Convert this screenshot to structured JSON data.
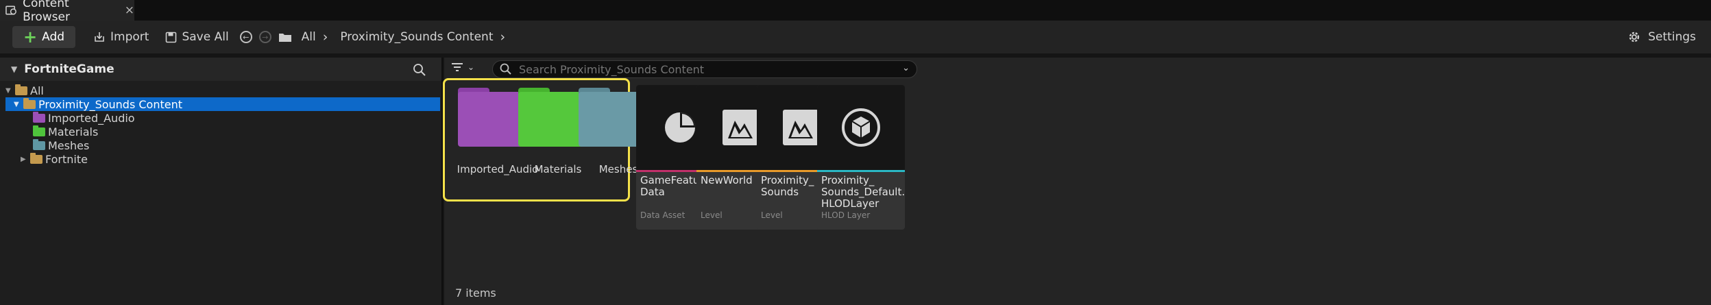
{
  "tab": {
    "title": "Content Browser",
    "close": "×"
  },
  "toolbar": {
    "add_label": "Add",
    "import_label": "Import",
    "save_all_label": "Save All",
    "breadcrumb": [
      "All",
      "Proximity_Sounds Content"
    ],
    "settings_label": "Settings"
  },
  "sources": {
    "title": "FortniteGame",
    "tree": [
      {
        "label": "All",
        "color": "#c49a4e"
      },
      {
        "label": "Proximity_Sounds Content",
        "color": "#c49a4e"
      },
      {
        "label": "Imported_Audio",
        "color": "#9b4fb6"
      },
      {
        "label": "Materials",
        "color": "#4fc43c"
      },
      {
        "label": "Meshes",
        "color": "#5f97a3"
      },
      {
        "label": "Fortnite",
        "color": "#c49a4e"
      }
    ]
  },
  "search": {
    "placeholder": "Search Proximity_Sounds Content"
  },
  "folders": [
    {
      "label": "Imported_Audio",
      "color": "#9b4fb6",
      "tab_color": "#8a3fa5"
    },
    {
      "label": "Materials",
      "color": "#55c83c",
      "tab_color": "#46b32e"
    },
    {
      "label": "Meshes",
      "color": "#6a9aa6",
      "tab_color": "#5a8793"
    }
  ],
  "assets": [
    {
      "name": "GameFeature\nData",
      "type": "Data Asset",
      "stripe": "#c2306a",
      "icon": "pie-chart-icon"
    },
    {
      "name": "NewWorld",
      "type": "Level",
      "stripe": "#e89a2a",
      "icon": "level-icon"
    },
    {
      "name": "Proximity_\nSounds",
      "type": "Level",
      "stripe": "#e89a2a",
      "icon": "level-icon"
    },
    {
      "name": "Proximity_\nSounds_Default...\nHLODLayer",
      "type": "HLOD Layer",
      "stripe": "#2bb7c4",
      "icon": "hlod-icon"
    }
  ],
  "status": {
    "items_count": "7 items"
  }
}
